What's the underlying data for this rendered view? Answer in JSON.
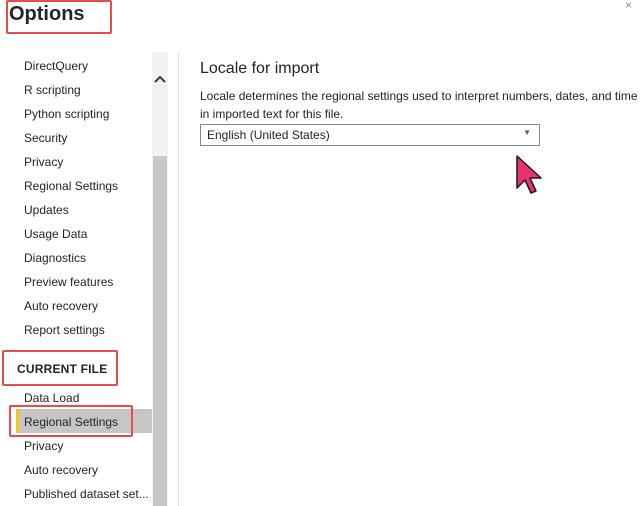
{
  "window": {
    "title": "Options",
    "close_glyph": "×"
  },
  "sidebar": {
    "global_items": [
      {
        "label": "DirectQuery"
      },
      {
        "label": "R scripting"
      },
      {
        "label": "Python scripting"
      },
      {
        "label": "Security"
      },
      {
        "label": "Privacy"
      },
      {
        "label": "Regional Settings"
      },
      {
        "label": "Updates"
      },
      {
        "label": "Usage Data"
      },
      {
        "label": "Diagnostics"
      },
      {
        "label": "Preview features"
      },
      {
        "label": "Auto recovery"
      },
      {
        "label": "Report settings"
      }
    ],
    "current_file_header": "CURRENT FILE",
    "current_file_items": [
      {
        "label": "Data Load"
      },
      {
        "label": "Regional Settings"
      },
      {
        "label": "Privacy"
      },
      {
        "label": "Auto recovery"
      },
      {
        "label": "Published dataset set..."
      }
    ],
    "scroll_up_glyph": "^"
  },
  "content": {
    "section_title": "Locale for import",
    "description": "Locale determines the regional settings used to interpret numbers, dates, and time in imported text for this file.",
    "locale_select": {
      "value": "English (United States)",
      "caret": "▼"
    }
  },
  "colors": {
    "highlight_border": "#e74c4c",
    "selected_accent": "#f2c811",
    "cursor": "#e8336f"
  }
}
